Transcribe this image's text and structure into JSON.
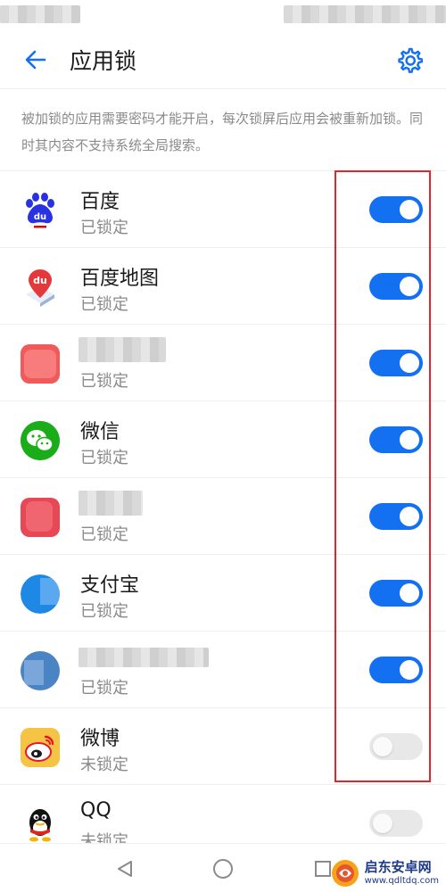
{
  "header": {
    "title": "应用锁"
  },
  "description": "被加锁的应用需要密码才能开启，每次锁屏后应用会被重新加锁。同时其内容不支持系统全局搜索。",
  "apps": [
    {
      "name": "百度",
      "status": "已锁定",
      "locked": true,
      "icon": "baidu-icon"
    },
    {
      "name": "百度地图",
      "status": "已锁定",
      "locked": true,
      "icon": "baidu-map-icon"
    },
    {
      "name": "",
      "status": "已锁定",
      "locked": true,
      "icon": "blurred-app-icon"
    },
    {
      "name": "微信",
      "status": "已锁定",
      "locked": true,
      "icon": "wechat-icon"
    },
    {
      "name": "",
      "status": "已锁定",
      "locked": true,
      "icon": "blurred-app-icon"
    },
    {
      "name": "支付宝",
      "status": "已锁定",
      "locked": true,
      "icon": "alipay-icon"
    },
    {
      "name": "",
      "status": "已锁定",
      "locked": true,
      "icon": "blurred-app-icon"
    },
    {
      "name": "微博",
      "status": "未锁定",
      "locked": false,
      "icon": "weibo-icon"
    },
    {
      "name": "QQ",
      "status": "未锁定",
      "locked": false,
      "icon": "qq-icon"
    }
  ],
  "watermark": {
    "title": "启东安卓网",
    "url": "www.qdltdq.com"
  },
  "colors": {
    "accent": "#1370f0",
    "annotation": "#e3262c",
    "toggle_off": "#e8e8e8"
  }
}
